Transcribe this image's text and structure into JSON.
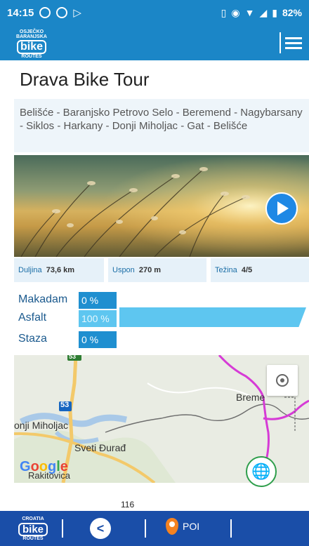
{
  "statusbar": {
    "time": "14:15",
    "battery": "82%"
  },
  "appbar": {
    "logo_lines": [
      "OSJEČKO",
      "BARANJSKA"
    ],
    "logo_big": "bike",
    "logo_small": "ROUTES"
  },
  "tour": {
    "title": "Drava Bike Tour",
    "route": "Belišće - Baranjsko Petrovo Selo - Beremend - Nagybarsany - Siklos - Harkany - Donji Miholjac - Gat - Belišće"
  },
  "stats": [
    {
      "label": "Duljina",
      "value": "73,6 km"
    },
    {
      "label": "Uspon",
      "value": "270 m"
    },
    {
      "label": "Težina",
      "value": "4/5"
    }
  ],
  "surface": [
    {
      "label": "Makadam",
      "percent": "0 %",
      "fraction": 0
    },
    {
      "label": "Asfalt",
      "percent": "100 %",
      "fraction": 1
    },
    {
      "label": "Staza",
      "percent": "0 %",
      "fraction": 0
    }
  ],
  "map": {
    "places": [
      "Breme",
      "onji Miholjac",
      "Sveti Đurađ",
      "Rakitovica"
    ],
    "roads": [
      "53",
      "53"
    ],
    "attribution": "Google"
  },
  "page_count": "116",
  "bottombar": {
    "logo_lines": [
      "CROATIA"
    ],
    "logo_big": "bike",
    "logo_small": "ROUTES",
    "poi_label": "POI"
  },
  "colors": {
    "primary": "#1b86c7",
    "bottom": "#1a4ea8",
    "bar_dark": "#1f8fd0",
    "bar_light": "#5ec6f0",
    "poi": "#f58220"
  }
}
